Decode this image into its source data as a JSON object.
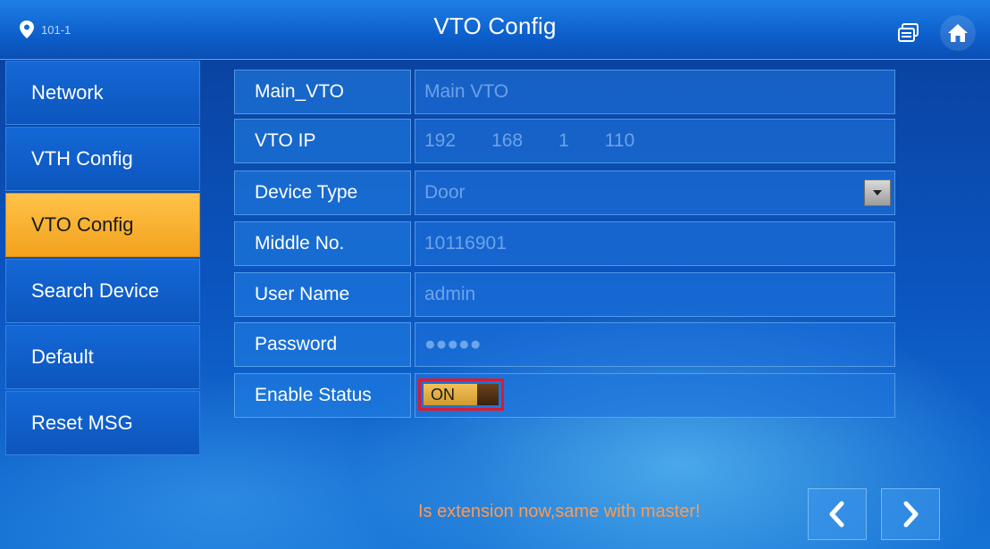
{
  "header": {
    "location": "101-1",
    "title": "VTO Config"
  },
  "sidebar": {
    "items": [
      {
        "label": "Network"
      },
      {
        "label": "VTH Config"
      },
      {
        "label": "VTO Config",
        "active": true
      },
      {
        "label": "Search Device"
      },
      {
        "label": "Default"
      },
      {
        "label": "Reset MSG"
      }
    ]
  },
  "form": {
    "main_vto": {
      "label": "Main_VTO",
      "value": "Main VTO"
    },
    "vto_ip": {
      "label": "VTO IP",
      "segments": [
        "192",
        "168",
        "1",
        "110"
      ]
    },
    "device_type": {
      "label": "Device Type",
      "value": "Door"
    },
    "middle_no": {
      "label": "Middle No.",
      "value": "10116901"
    },
    "user_name": {
      "label": "User Name",
      "value": "admin"
    },
    "password": {
      "label": "Password",
      "value": "●●●●●"
    },
    "enable_status": {
      "label": "Enable Status",
      "value": "ON"
    }
  },
  "footer": {
    "notice": "Is extension now,same with master!"
  },
  "icons": {
    "location": "location-pin-icon",
    "messages": "messages-icon",
    "home": "home-icon",
    "dropdown": "chevron-down-icon",
    "prev": "chevron-left-icon",
    "next": "chevron-right-icon"
  },
  "colors": {
    "accent_active": "#f3a21c",
    "notice": "#ff9a52",
    "highlight_box": "#e0192b"
  }
}
